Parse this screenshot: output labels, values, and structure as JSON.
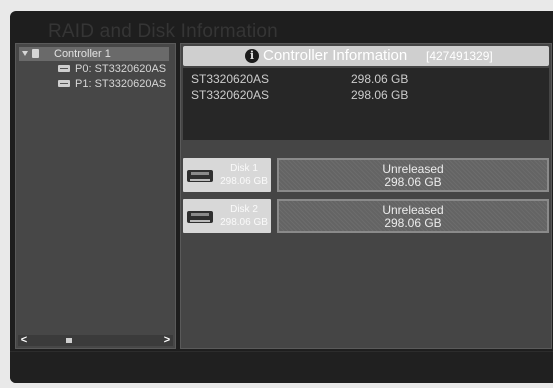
{
  "window": {
    "title": "RAID and Disk Information"
  },
  "tree": {
    "controller_label": "Controller 1",
    "disks": [
      "P0: ST3320620AS",
      "P1: ST3320620AS"
    ]
  },
  "scrollbar": {
    "left_arrow": "<",
    "right_arrow": ">"
  },
  "info": {
    "header_icon": "i",
    "header_title": "Controller Information",
    "serial": "[427491329]",
    "summary": [
      {
        "model": "ST3320620AS",
        "capacity": "298.06 GB"
      },
      {
        "model": "ST3320620AS",
        "capacity": "298.06 GB"
      }
    ]
  },
  "disks": [
    {
      "name": "Disk 1",
      "size": "298.06 GB",
      "status": "Unreleased",
      "status_size": "298.06 GB"
    },
    {
      "name": "Disk 2",
      "size": "298.06 GB",
      "status": "Unreleased",
      "status_size": "298.06 GB"
    }
  ],
  "icons": {
    "expand": "triangle-down-icon",
    "controller": "controller-icon",
    "disk": "hard-disk-icon",
    "info": "info-icon"
  }
}
